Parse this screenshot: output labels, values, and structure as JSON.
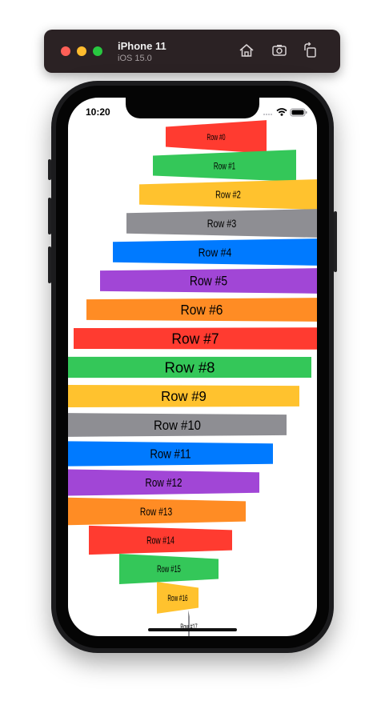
{
  "simulator": {
    "device_name": "iPhone 11",
    "os_version": "iOS 15.0",
    "buttons": [
      "home-icon",
      "screenshot-icon",
      "rotate-icon"
    ]
  },
  "status_bar": {
    "time": "10:20"
  },
  "list": {
    "rows": [
      {
        "label": "Row #0",
        "color": "#ff3b30"
      },
      {
        "label": "Row #1",
        "color": "#34c759"
      },
      {
        "label": "Row #2",
        "color": "#ffc22e"
      },
      {
        "label": "Row #3",
        "color": "#8e8e93"
      },
      {
        "label": "Row #4",
        "color": "#007aff"
      },
      {
        "label": "Row #5",
        "color": "#a146d6"
      },
      {
        "label": "Row #6",
        "color": "#ff8c24"
      },
      {
        "label": "Row #7",
        "color": "#ff3b30"
      },
      {
        "label": "Row #8",
        "color": "#34c759"
      },
      {
        "label": "Row #9",
        "color": "#ffc22e"
      },
      {
        "label": "Row #10",
        "color": "#8e8e93"
      },
      {
        "label": "Row #11",
        "color": "#007aff"
      },
      {
        "label": "Row #12",
        "color": "#a146d6"
      },
      {
        "label": "Row #13",
        "color": "#ff8c24"
      },
      {
        "label": "Row #14",
        "color": "#ff3b30"
      },
      {
        "label": "Row #15",
        "color": "#34c759"
      },
      {
        "label": "Row #16",
        "color": "#ffc22e"
      },
      {
        "label": "Row #17",
        "color": "#8e8e93"
      }
    ]
  }
}
